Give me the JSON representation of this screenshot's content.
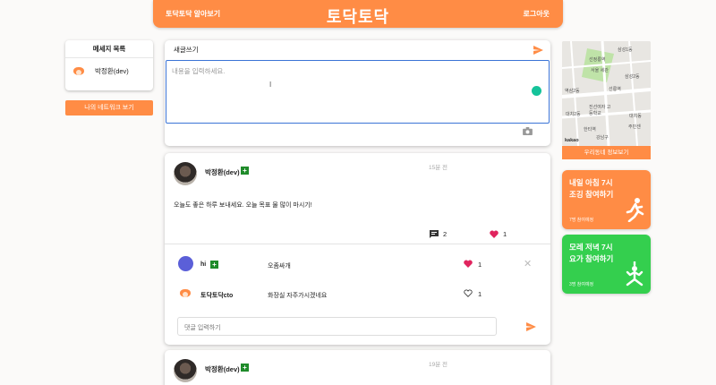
{
  "header": {
    "left_link": "토닥토닥 알아보기",
    "logo": "토닥토닥",
    "logout": "로그아웃"
  },
  "messages": {
    "title": "메세지 목록",
    "items": [
      {
        "name": "박정환(dev)"
      }
    ]
  },
  "network_button": "나의 네트워크 보기",
  "compose": {
    "title": "새글쓰기",
    "placeholder": "내용을 입력하세요."
  },
  "posts": [
    {
      "author": "박정환(dev)",
      "time": "15분 전",
      "content": "오늘도 좋은 하루 보내세요. 오늘 목표 물 많이 마시기!",
      "comment_count": "2",
      "like_count": "1",
      "comments": [
        {
          "name": "hi",
          "text": "오좀싸개",
          "likes": "1",
          "liked": true
        },
        {
          "name": "토닥토닥cto",
          "text": "화장실 자주가시겠네요",
          "likes": "1",
          "liked": false
        }
      ],
      "reply_placeholder": "댓글 입력하기"
    },
    {
      "author": "박정환(dev)",
      "time": "19분 전"
    }
  ],
  "map": {
    "labels": [
      "삼성1동",
      "선정릉역",
      "서울 세관",
      "선릉역",
      "역삼2동",
      "한티역",
      "진선여자 고등학교",
      "대치2동",
      "강남구",
      "삼성2동",
      "대치동",
      "주민센"
    ],
    "provider": "kakao",
    "button": "우리동네 정보보기"
  },
  "events": [
    {
      "title": "내일 아침 7시\n조깅 참여하기",
      "count": "7명 참여예정",
      "icon": "running-person-icon",
      "color": "#ff8c45"
    },
    {
      "title": "모레 저녁 7시\n요가 참여하기",
      "count": "3명 참여예정",
      "icon": "yoga-person-icon",
      "color": "#34cf4e"
    }
  ],
  "colors": {
    "accent": "#ff8c45",
    "green": "#34cf4e",
    "like": "#e0245e",
    "focus": "#3b74d6"
  }
}
